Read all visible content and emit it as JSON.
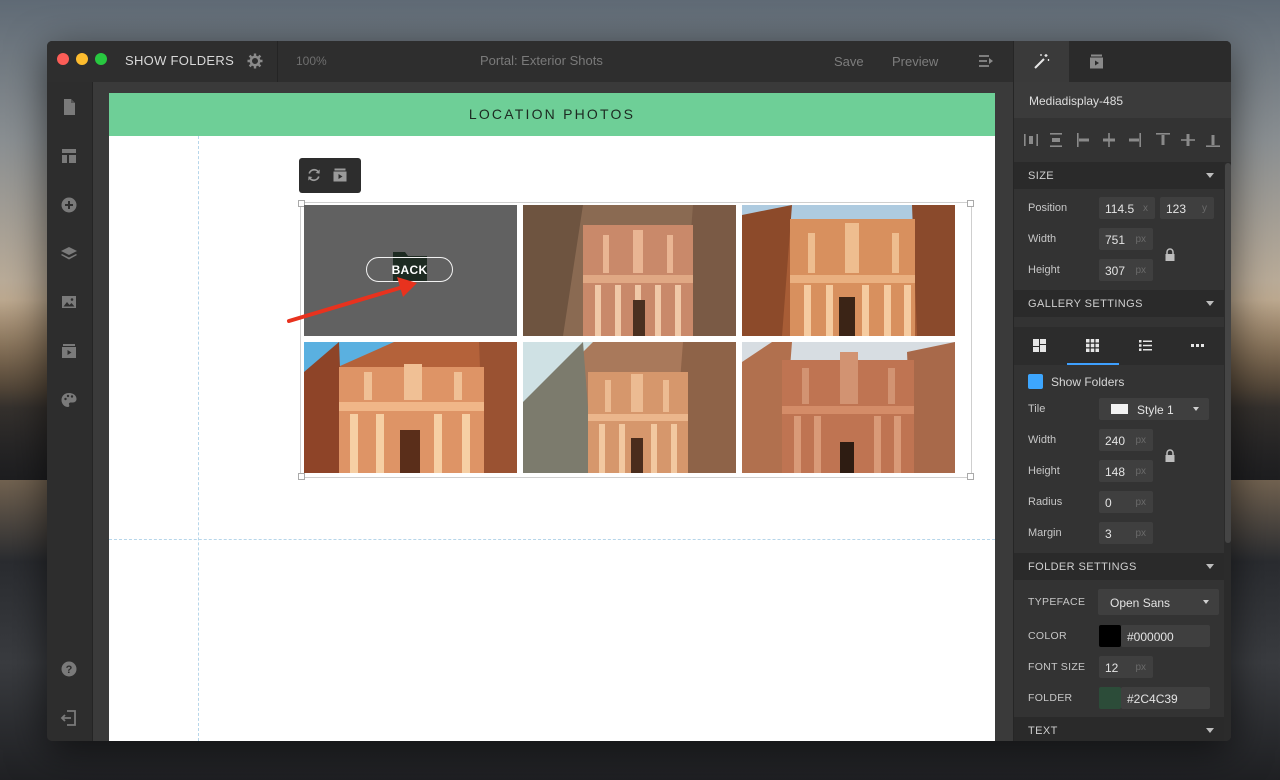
{
  "window": {
    "title": "SHOW FOLDERS",
    "zoom": "100%",
    "document": "Portal: Exterior Shots",
    "save_label": "Save",
    "preview_label": "Preview"
  },
  "sidebar": {
    "items": [
      {
        "icon": "page-icon"
      },
      {
        "icon": "layout-icon"
      },
      {
        "icon": "add-icon"
      },
      {
        "icon": "layers-icon"
      },
      {
        "icon": "image-icon"
      },
      {
        "icon": "media-icon"
      },
      {
        "icon": "palette-icon"
      }
    ],
    "bottom": [
      {
        "icon": "help-icon"
      },
      {
        "icon": "exit-icon"
      }
    ]
  },
  "page": {
    "banner_title": "LOCATION PHOTOS",
    "banner_color": "#6ecf97",
    "gallery": {
      "back_label": "BACK",
      "tiles": [
        {
          "type": "folder-back"
        },
        {
          "type": "photo",
          "subject": "petra-treasury"
        },
        {
          "type": "photo",
          "subject": "petra-treasury"
        },
        {
          "type": "photo",
          "subject": "petra-treasury"
        },
        {
          "type": "photo",
          "subject": "petra-treasury"
        },
        {
          "type": "photo",
          "subject": "petra-monastery"
        }
      ]
    }
  },
  "panel": {
    "element_id": "Mediadisplay-485",
    "size": {
      "header": "SIZE",
      "position_label": "Position",
      "x": "114.5",
      "x_unit": "x",
      "y": "123",
      "y_unit": "y",
      "width_label": "Width",
      "width": "751",
      "width_unit": "px",
      "height_label": "Height",
      "height": "307",
      "height_unit": "px"
    },
    "gallery_settings": {
      "header": "GALLERY SETTINGS",
      "show_folders_label": "Show Folders",
      "show_folders_checked": true,
      "tile_label": "Tile",
      "tile_value": "Style 1",
      "width_label": "Width",
      "width": "240",
      "width_unit": "px",
      "height_label": "Height",
      "height": "148",
      "height_unit": "px",
      "radius_label": "Radius",
      "radius": "0",
      "radius_unit": "px",
      "margin_label": "Margin",
      "margin": "3",
      "margin_unit": "px"
    },
    "folder_settings": {
      "header": "FOLDER SETTINGS",
      "typeface_label": "TYPEFACE",
      "typeface": "Open Sans",
      "color_label": "COLOR",
      "color": "#000000",
      "font_size_label": "FONT SIZE",
      "font_size": "12",
      "font_size_unit": "px",
      "folder_label": "FOLDER",
      "folder_color": "#2C4C39"
    },
    "text_header": "TEXT"
  },
  "colors": {
    "accent": "#3ea0ff",
    "checkbox": "#3da6ff",
    "arrow": "#e8321e"
  }
}
